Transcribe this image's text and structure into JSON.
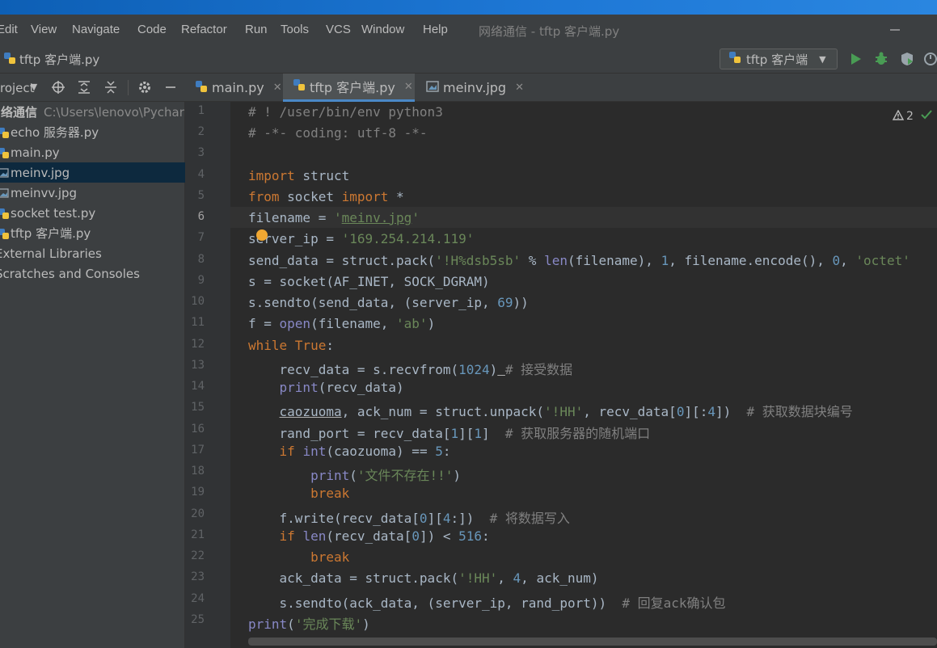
{
  "menubar": {
    "items": [
      "Edit",
      "View",
      "Navigate",
      "Code",
      "Refactor",
      "Run",
      "Tools",
      "VCS",
      "Window",
      "Help"
    ],
    "window_title": "网络通信 - tftp 客户端.py",
    "minimize_icon": "minimize-icon"
  },
  "navbar": {
    "breadcrumb_file": "tftp 客户端.py",
    "run_config": "tftp 客户端",
    "icons": [
      "run-icon",
      "debug-icon",
      "coverage-icon",
      "profile-icon"
    ]
  },
  "tool_window": {
    "label": "roject",
    "icons": [
      "locate-icon",
      "expand-all-icon",
      "collapse-all-icon",
      "settings-icon",
      "hide-icon"
    ]
  },
  "tabs": [
    {
      "label": "main.py",
      "active": false
    },
    {
      "label": "tftp 客户端.py",
      "active": true
    },
    {
      "label": "meinv.jpg",
      "active": false
    }
  ],
  "project_tree": {
    "root": {
      "name": "网络通信",
      "path": "C:\\Users\\lenovo\\Pycharm"
    },
    "files": [
      {
        "name": "echo 服务器.py",
        "type": "python",
        "selected": false
      },
      {
        "name": "main.py",
        "type": "python",
        "selected": false
      },
      {
        "name": "meinv.jpg",
        "type": "image",
        "selected": true
      },
      {
        "name": "meinvv.jpg",
        "type": "image",
        "selected": false
      },
      {
        "name": "socket test.py",
        "type": "python",
        "selected": false
      },
      {
        "name": "tftp 客户端.py",
        "type": "python",
        "selected": false
      }
    ],
    "external_libraries": "External Libraries",
    "scratches": "Scratches and Consoles"
  },
  "inspections": {
    "count": "2",
    "icon": "warning-icon"
  },
  "editor": {
    "current_line": 6,
    "lines": [
      {
        "n": "1",
        "code": "# ! /user/bin/env python3"
      },
      {
        "n": "2",
        "code": "# -*- coding: utf-8 -*-"
      },
      {
        "n": "3",
        "code": ""
      },
      {
        "n": "4",
        "code": "import struct"
      },
      {
        "n": "5",
        "code": "from socket import *"
      },
      {
        "n": "6",
        "code": "filename = 'meinv.jpg'"
      },
      {
        "n": "7",
        "code": "server_ip = '169.254.214.119'"
      },
      {
        "n": "8",
        "code": "send_data = struct.pack('!H%dsb5sb' % len(filename), 1, filename.encode(), 0, 'octet'"
      },
      {
        "n": "9",
        "code": "s = socket(AF_INET, SOCK_DGRAM)"
      },
      {
        "n": "10",
        "code": "s.sendto(send_data, (server_ip, 69))"
      },
      {
        "n": "11",
        "code": "f = open(filename, 'ab')"
      },
      {
        "n": "12",
        "code": "while True:"
      },
      {
        "n": "13",
        "code": "    recv_data = s.recvfrom(1024) # 接受数据"
      },
      {
        "n": "14",
        "code": "    print(recv_data)"
      },
      {
        "n": "15",
        "code": "    caozuoma, ack_num = struct.unpack('!HH', recv_data[0][:4])  # 获取数据块编号"
      },
      {
        "n": "16",
        "code": "    rand_port = recv_data[1][1]  # 获取服务器的随机端口"
      },
      {
        "n": "17",
        "code": "    if int(caozuoma) == 5:"
      },
      {
        "n": "18",
        "code": "        print('文件不存在!!')"
      },
      {
        "n": "19",
        "code": "        break"
      },
      {
        "n": "20",
        "code": "    f.write(recv_data[0][4:])  # 将数据写入"
      },
      {
        "n": "21",
        "code": "    if len(recv_data[0]) < 516:"
      },
      {
        "n": "22",
        "code": "        break"
      },
      {
        "n": "23",
        "code": "    ack_data = struct.pack('!HH', 4, ack_num)"
      },
      {
        "n": "24",
        "code": "    s.sendto(ack_data, (server_ip, rand_port))  # 回复ack确认包"
      },
      {
        "n": "25",
        "code": "print('完成下载')"
      }
    ]
  },
  "colors": {
    "keyword": "#cc7832",
    "string": "#6a8759",
    "number": "#6897bb",
    "comment": "#808080",
    "builtin": "#8888c6",
    "selection": "#0d293e"
  }
}
